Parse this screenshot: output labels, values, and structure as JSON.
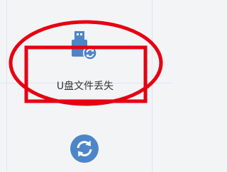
{
  "card": {
    "label": "U盘文件丢失",
    "icon": "usb-drive-sync-icon"
  },
  "secondary": {
    "icon": "sync-icon"
  },
  "colors": {
    "icon_blue": "#4d86c8",
    "annotation_red": "#e60012"
  }
}
